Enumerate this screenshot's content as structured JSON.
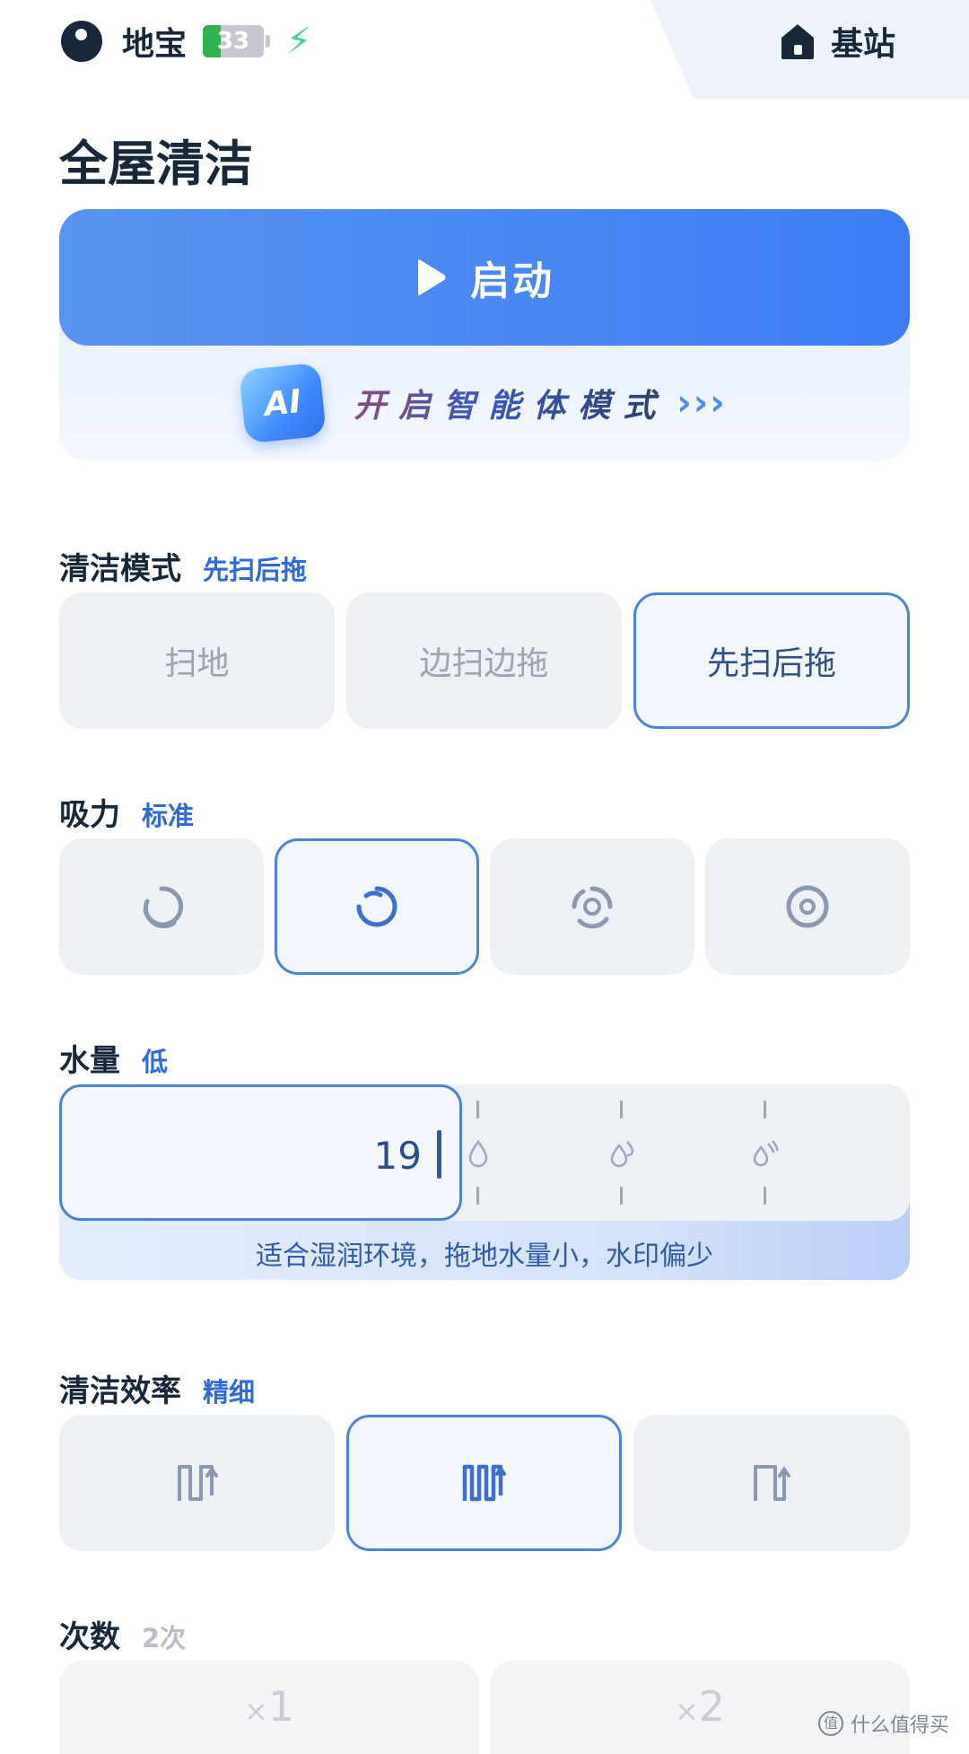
{
  "header": {
    "device_name": "地宝",
    "battery_percent": "33",
    "battery_level": 0.33,
    "charging_icon": "lightning-bolt-icon",
    "base_label": "基站"
  },
  "page_title": "全屋清洁",
  "start": {
    "label": "启动",
    "ai_label": "AI",
    "ai_mode_text": "开启智能体模式",
    "ai_chevrons": "›››"
  },
  "clean_mode": {
    "name": "清洁模式",
    "value": "先扫后拖",
    "options": [
      "扫地",
      "边扫边拖",
      "先扫后拖"
    ],
    "selected_index": 2
  },
  "suction": {
    "name": "吸力",
    "value": "标准",
    "options": [
      "suction-level-1-icon",
      "suction-level-2-icon",
      "suction-level-3-icon",
      "suction-level-4-icon"
    ],
    "selected_index": 1
  },
  "water": {
    "name": "水量",
    "value": "低",
    "level_value": "19",
    "level": 0.19,
    "marks": [
      "water-drop-low-icon",
      "water-drop-medium-icon",
      "water-drop-high-icon"
    ],
    "hint": "适合湿润环境，拖地水量小，水印偏少"
  },
  "efficiency": {
    "name": "清洁效率",
    "value": "精细",
    "options": [
      "path-standard-icon",
      "path-fine-icon",
      "path-fast-icon"
    ],
    "selected_index": 1
  },
  "count": {
    "name": "次数",
    "value": "2次",
    "options": [
      {
        "prefix": "×",
        "num": "1"
      },
      {
        "prefix": "×",
        "num": "2"
      }
    ]
  },
  "watermark": "什么值得买",
  "colors": {
    "accent": "#3c7df5",
    "selected_border": "#4d82d8",
    "option_bg": "#edf0f4",
    "text_dark": "#17283a"
  }
}
